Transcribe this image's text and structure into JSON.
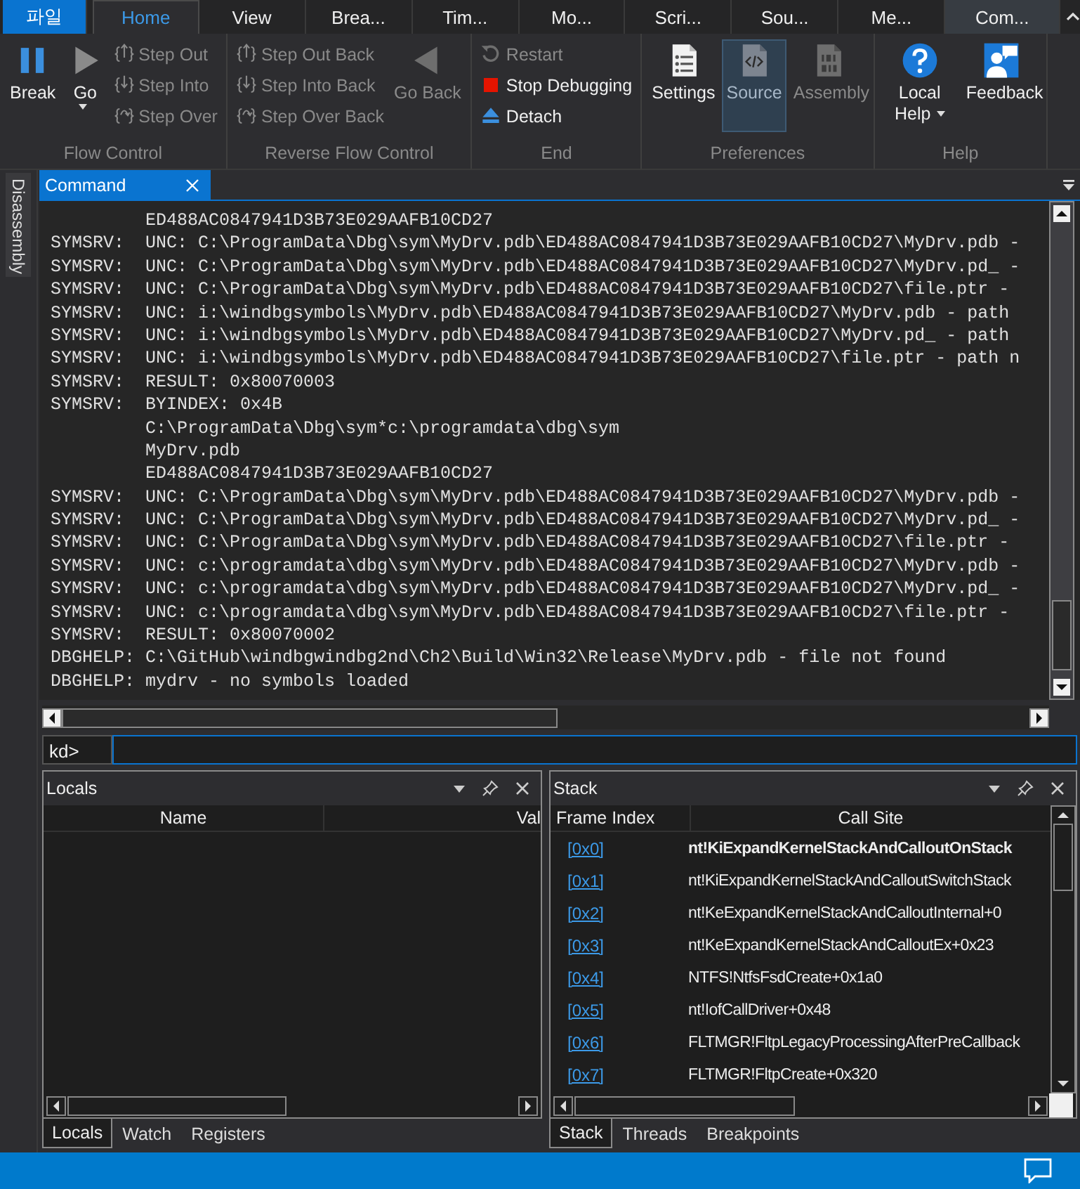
{
  "menu_tabs": [
    {
      "label": "파일",
      "kind": "file",
      "selected": false,
      "highlighted": false
    },
    {
      "label": "Home",
      "kind": "tab",
      "selected": true,
      "highlighted": false
    },
    {
      "label": "View",
      "kind": "tab",
      "selected": false,
      "highlighted": false
    },
    {
      "label": "Brea...",
      "kind": "tab",
      "selected": false,
      "highlighted": false
    },
    {
      "label": "Tim...",
      "kind": "tab",
      "selected": false,
      "highlighted": false
    },
    {
      "label": "Mo...",
      "kind": "tab",
      "selected": false,
      "highlighted": false
    },
    {
      "label": "Scri...",
      "kind": "tab",
      "selected": false,
      "highlighted": false
    },
    {
      "label": "Sou...",
      "kind": "tab",
      "selected": false,
      "highlighted": false
    },
    {
      "label": "Me...",
      "kind": "tab",
      "selected": false,
      "highlighted": false
    },
    {
      "label": "Com...",
      "kind": "tab",
      "selected": false,
      "highlighted": true
    }
  ],
  "ribbon": [
    {
      "label": "Flow Control",
      "columns": [
        [
          {
            "label": "Break",
            "kind": "pause",
            "disabled": false
          }
        ],
        [
          {
            "label": "Go",
            "kind": "play",
            "disabled": false,
            "dropdown": true
          }
        ],
        [
          {
            "label": "Step Out",
            "kind": "stepout",
            "disabled": true
          },
          {
            "label": "Step Into",
            "kind": "stepinto",
            "disabled": true
          },
          {
            "label": "Step Over",
            "kind": "stepover",
            "disabled": true
          }
        ]
      ]
    },
    {
      "label": "Reverse Flow Control",
      "columns": [
        [
          {
            "label": "Step Out Back",
            "kind": "stepout",
            "disabled": true
          },
          {
            "label": "Step Into Back",
            "kind": "stepinto",
            "disabled": true
          },
          {
            "label": "Step Over Back",
            "kind": "stepover",
            "disabled": true
          }
        ],
        [
          {
            "label": "Go Back",
            "kind": "back",
            "disabled": true
          }
        ]
      ]
    },
    {
      "label": "End",
      "columns": [
        [
          {
            "label": "Restart",
            "kind": "restart",
            "disabled": true
          },
          {
            "label": "Stop Debugging",
            "kind": "stop",
            "disabled": false
          },
          {
            "label": "Detach",
            "kind": "detach",
            "disabled": false
          }
        ]
      ]
    },
    {
      "label": "Preferences",
      "columns": [
        [
          {
            "label": "Settings",
            "kind": "settings",
            "disabled": false,
            "selected": false
          }
        ],
        [
          {
            "label": "Source",
            "kind": "source",
            "disabled": false,
            "selected": true
          }
        ],
        [
          {
            "label": "Assembly",
            "kind": "assembly",
            "disabled": true,
            "selected": false
          }
        ]
      ]
    },
    {
      "label": "Help",
      "columns": [
        [
          {
            "label": "Local Help",
            "kind": "help",
            "disabled": false,
            "dropdown": true
          }
        ],
        [
          {
            "label": "Feedback",
            "kind": "feedback",
            "disabled": false
          }
        ]
      ]
    }
  ],
  "side_tab": "Disassembly",
  "command": {
    "title": "Command",
    "lines": [
      {
        "text": "ED488AC0847941D3B73E029AAFB10CD27"
      },
      {
        "source": "SYMSRV:",
        "text": "UNC: C:\\ProgramData\\Dbg\\sym\\MyDrv.pdb\\ED488AC0847941D3B73E029AAFB10CD27\\MyDrv.pdb -"
      },
      {
        "source": "SYMSRV:",
        "text": "UNC: C:\\ProgramData\\Dbg\\sym\\MyDrv.pdb\\ED488AC0847941D3B73E029AAFB10CD27\\MyDrv.pd_ -"
      },
      {
        "source": "SYMSRV:",
        "text": "UNC: C:\\ProgramData\\Dbg\\sym\\MyDrv.pdb\\ED488AC0847941D3B73E029AAFB10CD27\\file.ptr -"
      },
      {
        "source": "SYMSRV:",
        "text": "UNC: i:\\windbgsymbols\\MyDrv.pdb\\ED488AC0847941D3B73E029AAFB10CD27\\MyDrv.pdb - path"
      },
      {
        "source": "SYMSRV:",
        "text": "UNC: i:\\windbgsymbols\\MyDrv.pdb\\ED488AC0847941D3B73E029AAFB10CD27\\MyDrv.pd_ - path"
      },
      {
        "source": "SYMSRV:",
        "text": "UNC: i:\\windbgsymbols\\MyDrv.pdb\\ED488AC0847941D3B73E029AAFB10CD27\\file.ptr - path n"
      },
      {
        "source": "SYMSRV:",
        "text": "RESULT: 0x80070003"
      },
      {
        "source": "SYMSRV:",
        "text": "BYINDEX: 0x4B"
      },
      {
        "text": "C:\\ProgramData\\Dbg\\sym*c:\\programdata\\dbg\\sym"
      },
      {
        "text": "MyDrv.pdb"
      },
      {
        "text": "ED488AC0847941D3B73E029AAFB10CD27"
      },
      {
        "source": "SYMSRV:",
        "text": "UNC: C:\\ProgramData\\Dbg\\sym\\MyDrv.pdb\\ED488AC0847941D3B73E029AAFB10CD27\\MyDrv.pdb -"
      },
      {
        "source": "SYMSRV:",
        "text": "UNC: C:\\ProgramData\\Dbg\\sym\\MyDrv.pdb\\ED488AC0847941D3B73E029AAFB10CD27\\MyDrv.pd_ -"
      },
      {
        "source": "SYMSRV:",
        "text": "UNC: C:\\ProgramData\\Dbg\\sym\\MyDrv.pdb\\ED488AC0847941D3B73E029AAFB10CD27\\file.ptr -"
      },
      {
        "source": "SYMSRV:",
        "text": "UNC: c:\\programdata\\dbg\\sym\\MyDrv.pdb\\ED488AC0847941D3B73E029AAFB10CD27\\MyDrv.pdb -"
      },
      {
        "source": "SYMSRV:",
        "text": "UNC: c:\\programdata\\dbg\\sym\\MyDrv.pdb\\ED488AC0847941D3B73E029AAFB10CD27\\MyDrv.pd_ -"
      },
      {
        "source": "SYMSRV:",
        "text": "UNC: c:\\programdata\\dbg\\sym\\MyDrv.pdb\\ED488AC0847941D3B73E029AAFB10CD27\\file.ptr -"
      },
      {
        "source": "SYMSRV:",
        "text": "RESULT: 0x80070002"
      },
      {
        "source": "DBGHELP:",
        "text": "C:\\GitHub\\windbgwindbg2nd\\Ch2\\Build\\Win32\\Release\\MyDrv.pdb - file not found"
      },
      {
        "source": "DBGHELP:",
        "text": "mydrv - no symbols loaded"
      }
    ],
    "prompt": "kd>"
  },
  "locals": {
    "title": "Locals",
    "columns": [
      "Name",
      "Val"
    ],
    "tabs": [
      {
        "label": "Locals",
        "selected": true
      },
      {
        "label": "Watch",
        "selected": false
      },
      {
        "label": "Registers",
        "selected": false
      }
    ]
  },
  "stack": {
    "title": "Stack",
    "columns": [
      "Frame Index",
      "Call Site"
    ],
    "rows": [
      {
        "index": "[0x0]",
        "call_site": "nt!KiExpandKernelStackAndCalloutOnStack",
        "current": true
      },
      {
        "index": "[0x1]",
        "call_site": "nt!KiExpandKernelStackAndCalloutSwitchStack",
        "current": false
      },
      {
        "index": "[0x2]",
        "call_site": "nt!KeExpandKernelStackAndCalloutInternal+0",
        "current": false
      },
      {
        "index": "[0x3]",
        "call_site": "nt!KeExpandKernelStackAndCalloutEx+0x23",
        "current": false
      },
      {
        "index": "[0x4]",
        "call_site": "NTFS!NtfsFsdCreate+0x1a0",
        "current": false
      },
      {
        "index": "[0x5]",
        "call_site": "nt!IofCallDriver+0x48",
        "current": false
      },
      {
        "index": "[0x6]",
        "call_site": "FLTMGR!FltpLegacyProcessingAfterPreCallback",
        "current": false
      },
      {
        "index": "[0x7]",
        "call_site": "FLTMGR!FltpCreate+0x320",
        "current": false
      }
    ],
    "tabs": [
      {
        "label": "Stack",
        "selected": true
      },
      {
        "label": "Threads",
        "selected": false
      },
      {
        "label": "Breakpoints",
        "selected": false
      }
    ]
  }
}
